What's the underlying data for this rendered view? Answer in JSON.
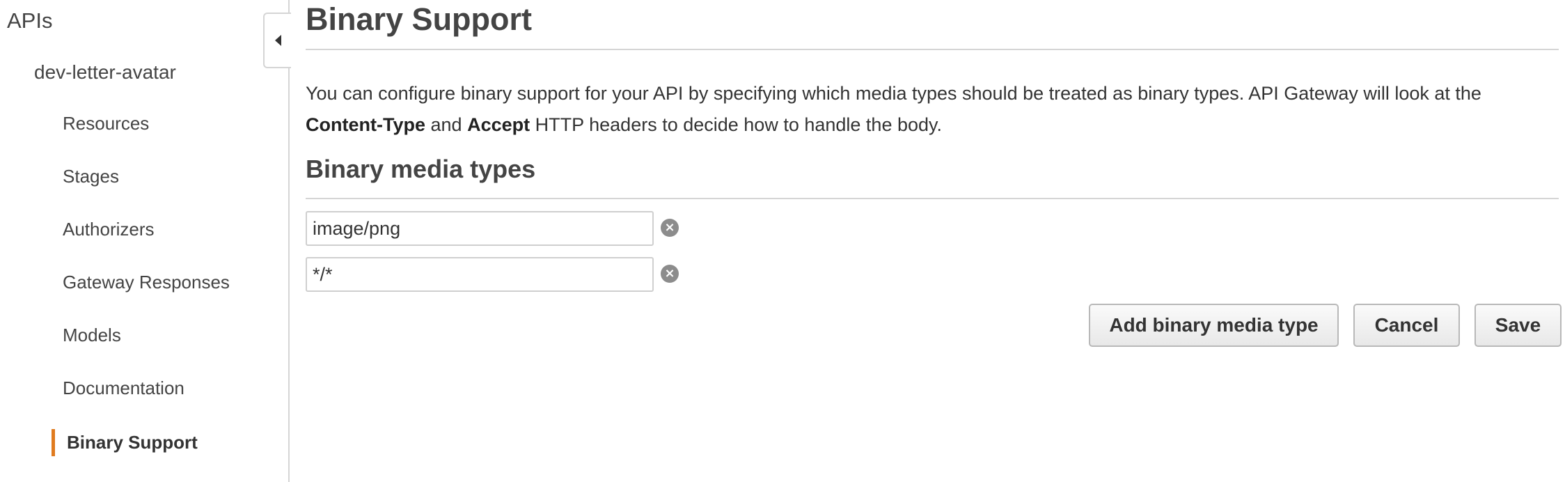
{
  "sidebar": {
    "apis_title": "APIs",
    "api_name": "dev-letter-avatar",
    "items": [
      {
        "label": "Resources"
      },
      {
        "label": "Stages"
      },
      {
        "label": "Authorizers"
      },
      {
        "label": "Gateway Responses"
      },
      {
        "label": "Models"
      },
      {
        "label": "Documentation"
      },
      {
        "label": "Binary Support",
        "active": true
      }
    ],
    "accent_color": "#e07b1f"
  },
  "main": {
    "title": "Binary Support",
    "description": {
      "part1": "You can configure binary support for your API by specifying which media types should be treated as binary types. API Gateway will look at the",
      "bold1": "Content-Type",
      "part2": "and",
      "bold2": "Accept",
      "part3": "HTTP headers to decide how to handle the body."
    },
    "section_title": "Binary media types",
    "media_types": [
      {
        "value": "image/png"
      },
      {
        "value": "*/*"
      }
    ],
    "buttons": {
      "add": "Add binary media type",
      "cancel": "Cancel",
      "save": "Save"
    }
  },
  "icons": {
    "collapse": "collapse-left-icon",
    "remove": "remove-circle-x-icon"
  }
}
